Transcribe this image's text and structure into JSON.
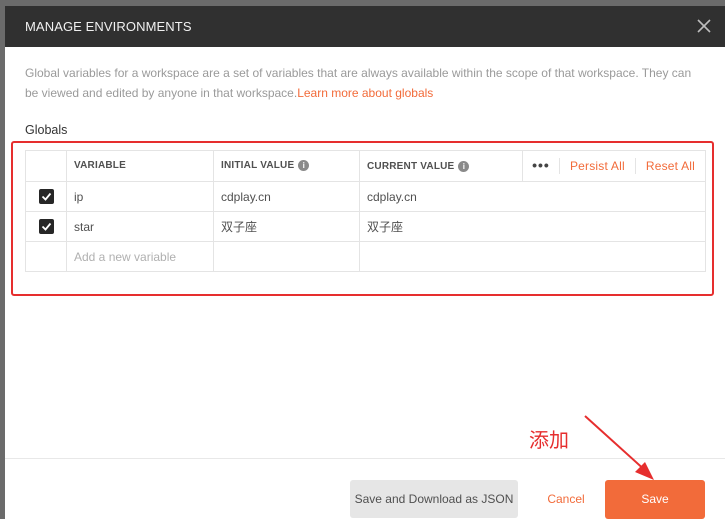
{
  "dialog": {
    "title": "MANAGE ENVIRONMENTS",
    "description": "Global variables for a workspace are a set of variables that are always available within the scope of that workspace. They can be viewed and edited by anyone in that workspace.",
    "learn_more": "Learn more about globals",
    "section_label": "Globals"
  },
  "table": {
    "headers": {
      "variable": "VARIABLE",
      "initial_value": "INITIAL VALUE",
      "current_value": "CURRENT VALUE",
      "more": "•••",
      "persist_all": "Persist All",
      "reset_all": "Reset All"
    },
    "rows": [
      {
        "enabled": true,
        "variable": "ip",
        "initial": "cdplay.cn",
        "current": "cdplay.cn"
      },
      {
        "enabled": true,
        "variable": "star",
        "initial": "双子座",
        "current": "双子座"
      }
    ],
    "new_row_placeholder": "Add a new variable"
  },
  "footer": {
    "save_json_label": "Save and Download as JSON",
    "cancel_label": "Cancel",
    "save_label": "Save"
  },
  "annotation": {
    "text": "添加"
  },
  "colors": {
    "accent": "#f26b3a",
    "header_bg": "#303030",
    "highlight_red": "#e62e2e"
  },
  "icons": {
    "close": "close-icon",
    "info": "info-icon",
    "check": "check-icon",
    "arrow": "arrow-icon"
  }
}
